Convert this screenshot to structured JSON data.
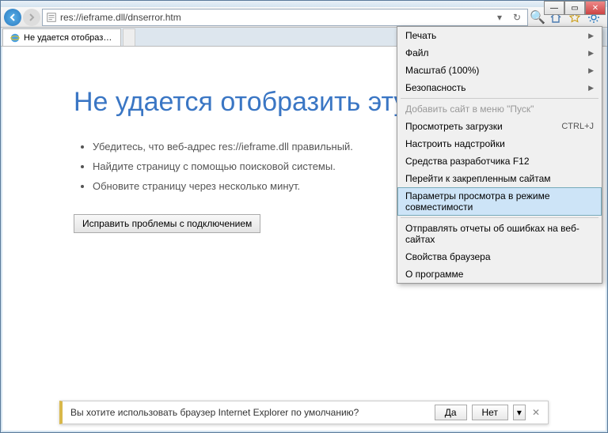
{
  "address_bar": {
    "url": "res://ieframe.dll/dnserror.htm"
  },
  "tab": {
    "title": "Не удается отобразить эту..."
  },
  "page": {
    "heading": "Не удается отобразить эту страницу",
    "bullets": [
      "Убедитесь, что веб-адрес res://ieframe.dll правильный.",
      "Найдите страницу с помощью поисковой системы.",
      "Обновите страницу через несколько минут."
    ],
    "fix_button": "Исправить проблемы с подключением"
  },
  "menu": {
    "print": "Печать",
    "file": "Файл",
    "zoom": "Масштаб (100%)",
    "safety": "Безопасность",
    "add_start": "Добавить сайт в меню \"Пуск\"",
    "downloads": "Просмотреть загрузки",
    "downloads_shortcut": "CTRL+J",
    "addons": "Настроить надстройки",
    "devtools": "Средства разработчика F12",
    "pinned": "Перейти к закрепленным сайтам",
    "compat": "Параметры просмотра в режиме совместимости",
    "report": "Отправлять отчеты об ошибках на веб-сайтах",
    "props": "Свойства браузера",
    "about": "О программе"
  },
  "bottombar": {
    "message": "Вы хотите использовать браузер Internet Explorer по умолчанию?",
    "yes": "Да",
    "no": "Нет"
  }
}
